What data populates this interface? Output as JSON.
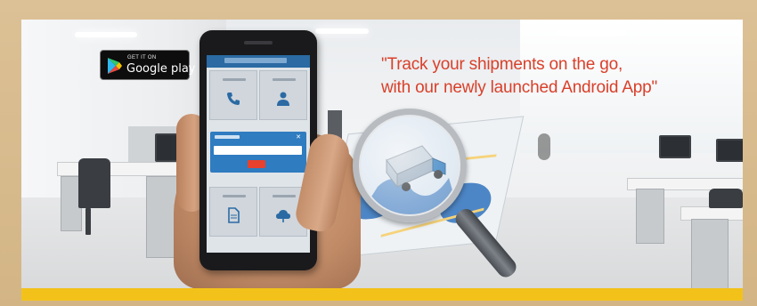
{
  "banner": {
    "headline": {
      "line1": "\"Track your shipments on the go,",
      "line2": "with our newly launched Android App\""
    },
    "google_play_badge": {
      "top_text": "GET IT ON",
      "label": "Google play"
    }
  },
  "colors": {
    "headline": "#d9402a",
    "frame": "#d8b989",
    "accent_bar": "#f2c21a",
    "app_blue": "#2f7cc0"
  }
}
